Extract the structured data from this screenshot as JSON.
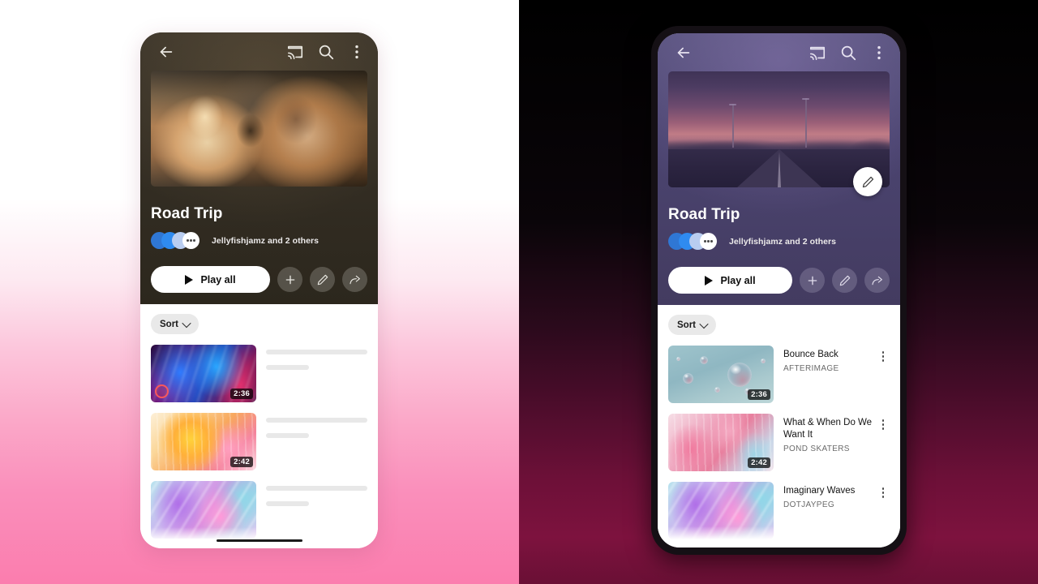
{
  "theme": {
    "left_bg_top": "#ffffff",
    "left_bg_bottom": "#fb7dae",
    "right_bg_top": "#000000",
    "right_bg_bottom": "#7d123e",
    "left_header_bg": "#2e2a20",
    "right_header_bg": "#4a4266",
    "accent_white": "#ffffff",
    "chip_bg": "#e9e9e9",
    "skeleton_bar": "#e8e8e8"
  },
  "appbar": {
    "back_icon": "back-arrow-icon",
    "cast_icon": "cast-icon",
    "search_icon": "search-icon",
    "overflow_icon": "overflow-menu-icon"
  },
  "playlist": {
    "title": "Road Trip",
    "owners_text": "Jellyfishjamz and 2 others",
    "avatar_colors": [
      "#2f77d4",
      "#2f8bf0",
      "#b9cdf0",
      "#ffffff"
    ],
    "play_all_label": "Play all",
    "actions": [
      {
        "name": "add-button",
        "icon": "plus-icon"
      },
      {
        "name": "edit-button",
        "icon": "pencil-icon"
      },
      {
        "name": "share-button",
        "icon": "share-arrow-icon"
      }
    ],
    "edit_fab_icon": "pencil-icon"
  },
  "list": {
    "sort_label": "Sort",
    "sort_chevron_icon": "chevron-down-icon",
    "kebab_icon": "overflow-menu-icon"
  },
  "left_phone": {
    "variant": "loading-skeleton",
    "hero_image": "two-friends-in-car-sunset-photo",
    "songs": [
      {
        "duration": "2:36",
        "artwork": "blue-magenta-waves",
        "badge": "live-ring-badge"
      },
      {
        "duration": "2:42",
        "artwork": "orange-pink-sunrise",
        "badge": ""
      },
      {
        "duration": "",
        "artwork": "purple-teal-marble",
        "badge": ""
      }
    ]
  },
  "right_phone": {
    "variant": "loaded-content",
    "hero_image": "twilight-highway-sunset-photo",
    "songs": [
      {
        "title": "Bounce Back",
        "artist": "AFTERIMAGE",
        "duration": "2:36",
        "artwork": "water-droplets-bubbles"
      },
      {
        "title": "What & When Do We Want It",
        "artist": "POND SKATERS",
        "duration": "2:42",
        "artwork": "pink-blue-liquid"
      },
      {
        "title": "Imaginary Waves",
        "artist": "DOTJAYPEG",
        "duration": "",
        "artwork": "purple-teal-marble"
      }
    ]
  }
}
